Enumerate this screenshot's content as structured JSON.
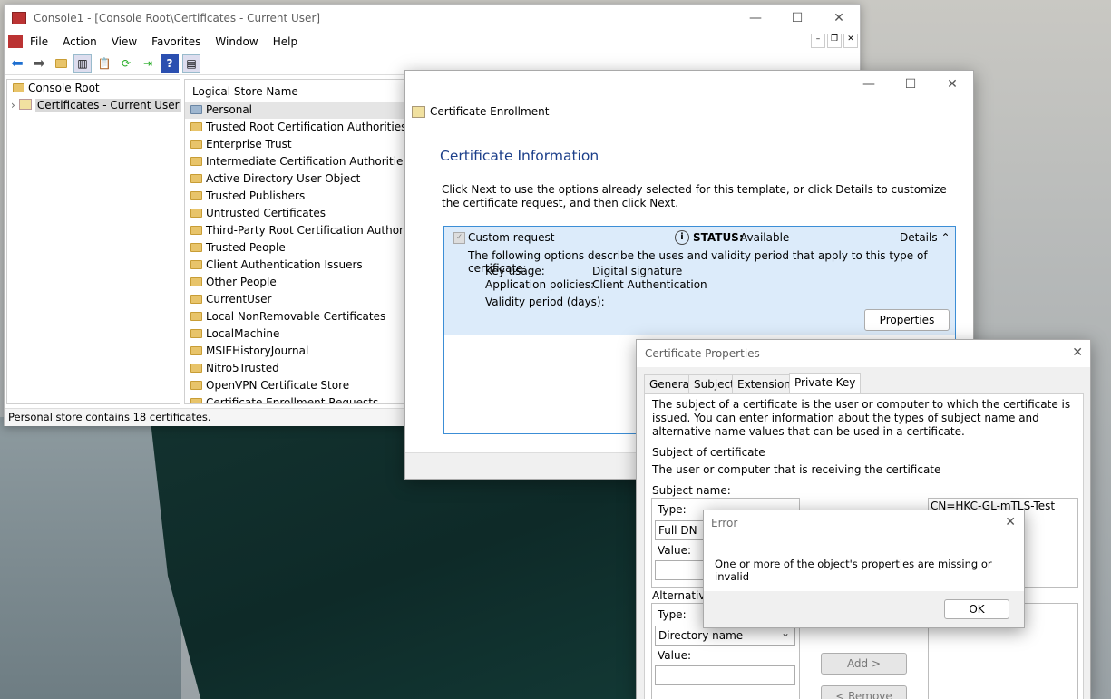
{
  "mmc": {
    "title": "Console1 - [Console Root\\Certificates - Current User]",
    "menu": [
      "File",
      "Action",
      "View",
      "Favorites",
      "Window",
      "Help"
    ],
    "tree": {
      "root": "Console Root",
      "child": "Certificates - Current User"
    },
    "list_header": "Logical Store Name",
    "stores": [
      "Personal",
      "Trusted Root Certification Authorities",
      "Enterprise Trust",
      "Intermediate Certification Authorities",
      "Active Directory User Object",
      "Trusted Publishers",
      "Untrusted Certificates",
      "Third-Party Root Certification Authorities",
      "Trusted People",
      "Client Authentication Issuers",
      "Other People",
      "CurrentUser",
      "Local NonRemovable Certificates",
      "LocalMachine",
      "MSIEHistoryJournal",
      "Nitro5Trusted",
      "OpenVPN Certificate Store",
      "Certificate Enrollment Requests"
    ],
    "status": "Personal store contains 18 certificates."
  },
  "enroll": {
    "title": "Certificate Enrollment",
    "heading": "Certificate Information",
    "intro": "Click Next to use the options already selected for this template, or click Details to customize the certificate request, and then click Next.",
    "template": "Custom request",
    "status_label": "STATUS:",
    "status_value": "Available",
    "details": "Details",
    "desc": "The following options describe the uses and validity period that apply to this type of certificate:",
    "key_usage_label": "Key usage:",
    "key_usage": "Digital signature",
    "app_policies_label": "Application policies:",
    "app_policies": "Client Authentication",
    "validity_label": "Validity period (days):",
    "properties_btn": "Properties"
  },
  "props": {
    "title": "Certificate Properties",
    "tabs": [
      "General",
      "Subject",
      "Extensions",
      "Private Key"
    ],
    "intro": "The subject of a certificate is the user or computer to which the certificate is issued. You can enter information about the types of subject name and alternative name values that can be used in a certificate.",
    "subject_heading": "Subject of certificate",
    "subject_sub": "The user or computer that is receiving the certificate",
    "subject_name_label": "Subject name:",
    "type_label": "Type:",
    "type_value": "Full DN",
    "value_label": "Value:",
    "cn_value": "CN=HKC-GL-mTLS-Test",
    "alt_label": "Alternative",
    "alt_type_value": "Directory name",
    "add_btn": "Add >",
    "remove_btn": "< Remove"
  },
  "error": {
    "title": "Error",
    "message": "One or more of the object's properties are missing or invalid",
    "ok": "OK"
  }
}
